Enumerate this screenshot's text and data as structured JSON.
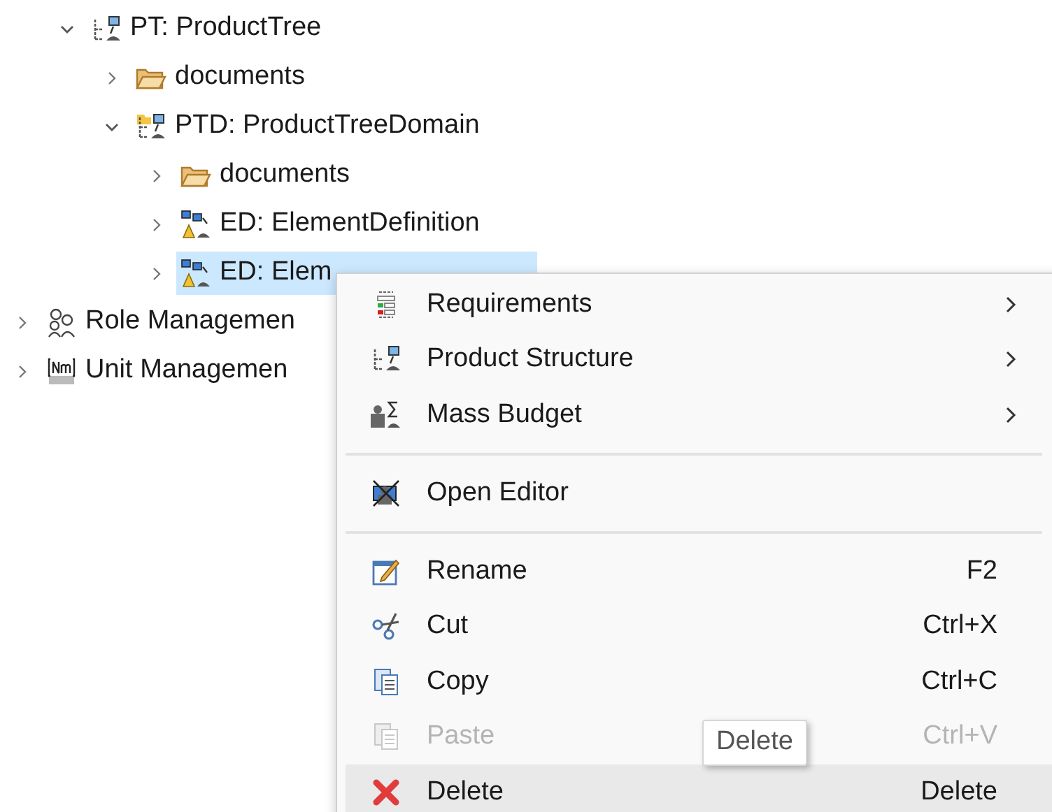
{
  "tree": {
    "nested_items": [
      {
        "label": "PT: ProductTree",
        "kind": "tree",
        "expanded": true,
        "selected": false,
        "children": [
          {
            "label": "documents",
            "kind": "folder",
            "expanded": false,
            "selected": false
          },
          {
            "label": "PTD: ProductTreeDomain",
            "kind": "tree-domain",
            "expanded": true,
            "selected": false,
            "children": [
              {
                "label": "documents",
                "kind": "folder",
                "expanded": false,
                "selected": false
              },
              {
                "label": "ED: ElementDefinition",
                "kind": "element",
                "expanded": false,
                "selected": false
              },
              {
                "label": "ED: Elem",
                "kind": "element",
                "expanded": false,
                "selected": true
              }
            ]
          }
        ]
      }
    ],
    "items": [
      {
        "label": "Role Managemen",
        "kind": "roles",
        "expanded": false,
        "selected": false
      },
      {
        "label": "Unit Managemen",
        "kind": "units",
        "expanded": false,
        "selected": false
      }
    ]
  },
  "context_menu": {
    "items": [
      {
        "kind": "submenu",
        "label": "Requirements",
        "disabled": false,
        "selected": false
      },
      {
        "kind": "submenu",
        "label": "Product Structure",
        "disabled": false,
        "selected": false
      },
      {
        "kind": "submenu",
        "label": "Mass Budget",
        "disabled": false,
        "selected": false
      },
      {
        "kind": "separator"
      },
      {
        "kind": "command",
        "label": "Open Editor",
        "disabled": false,
        "selected": false
      },
      {
        "kind": "separator"
      },
      {
        "kind": "command",
        "label": "Rename",
        "shortcut": "F2",
        "disabled": false,
        "selected": false
      },
      {
        "kind": "command",
        "label": "Cut",
        "shortcut": "Ctrl+X",
        "disabled": false,
        "selected": false
      },
      {
        "kind": "command",
        "label": "Copy",
        "shortcut": "Ctrl+C",
        "disabled": false,
        "selected": false
      },
      {
        "kind": "command",
        "label": "Paste",
        "shortcut": "Ctrl+V",
        "disabled": true,
        "selected": false
      },
      {
        "kind": "command",
        "label": "Delete",
        "shortcut": "Delete",
        "disabled": false,
        "selected": true
      }
    ]
  },
  "tooltip": {
    "text": "Delete"
  }
}
